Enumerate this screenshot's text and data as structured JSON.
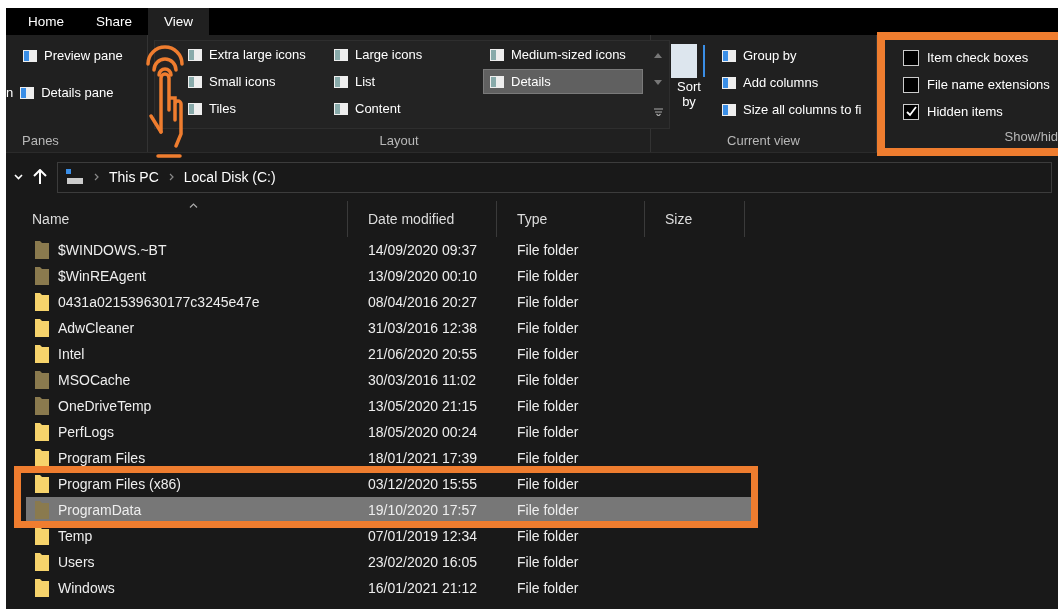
{
  "tabs": [
    {
      "label": "Home",
      "selected": false
    },
    {
      "label": "Share",
      "selected": false
    },
    {
      "label": "View",
      "selected": true
    }
  ],
  "ribbon": {
    "panes": {
      "cut_label": "n",
      "items": [
        "Preview pane",
        "Details pane"
      ],
      "group": "Panes"
    },
    "layout": {
      "group": "Layout",
      "columns": [
        [
          {
            "label": "Extra large icons",
            "selected": false
          },
          {
            "label": "Small icons",
            "selected": false
          },
          {
            "label": "Tiles",
            "selected": false
          }
        ],
        [
          {
            "label": "Large icons",
            "selected": false
          },
          {
            "label": "List",
            "selected": false
          },
          {
            "label": "Content",
            "selected": false
          }
        ],
        [
          {
            "label": "Medium-sized icons",
            "selected": false
          },
          {
            "label": "Details",
            "selected": true
          }
        ]
      ]
    },
    "current_view": {
      "sort_lines": [
        "Sort",
        "by"
      ],
      "items": [
        "Group by",
        "Add columns",
        "Size all columns to fi"
      ],
      "group": "Current view"
    },
    "show_hide": {
      "highlighted": true,
      "group": "Show/hid",
      "options": [
        {
          "label": "Item check boxes",
          "checked": false
        },
        {
          "label": "File name extensions",
          "checked": false
        },
        {
          "label": "Hidden items",
          "checked": true
        }
      ]
    }
  },
  "address": {
    "crumbs": [
      "This PC",
      "Local Disk (C:)"
    ]
  },
  "table": {
    "columns": [
      "Name",
      "Date modified",
      "Type",
      "Size"
    ],
    "rows": [
      {
        "name": "$WINDOWS.~BT",
        "date": "14/09/2020 09:37",
        "type": "File folder",
        "hidden": true,
        "selected": false,
        "highlighted": false
      },
      {
        "name": "$WinREAgent",
        "date": "13/09/2020 00:10",
        "type": "File folder",
        "hidden": true,
        "selected": false,
        "highlighted": false
      },
      {
        "name": "0431a021539630177c3245e47e",
        "date": "08/04/2016 20:27",
        "type": "File folder",
        "hidden": false,
        "selected": false,
        "highlighted": false
      },
      {
        "name": "AdwCleaner",
        "date": "31/03/2016 12:38",
        "type": "File folder",
        "hidden": false,
        "selected": false,
        "highlighted": false
      },
      {
        "name": "Intel",
        "date": "21/06/2020 20:55",
        "type": "File folder",
        "hidden": false,
        "selected": false,
        "highlighted": false
      },
      {
        "name": "MSOCache",
        "date": "30/03/2016 11:02",
        "type": "File folder",
        "hidden": true,
        "selected": false,
        "highlighted": false
      },
      {
        "name": "OneDriveTemp",
        "date": "13/05/2020 21:15",
        "type": "File folder",
        "hidden": true,
        "selected": false,
        "highlighted": false
      },
      {
        "name": "PerfLogs",
        "date": "18/05/2020 00:24",
        "type": "File folder",
        "hidden": false,
        "selected": false,
        "highlighted": false
      },
      {
        "name": "Program Files",
        "date": "18/01/2021 17:39",
        "type": "File folder",
        "hidden": false,
        "selected": false,
        "highlighted": false
      },
      {
        "name": "Program Files (x86)",
        "date": "03/12/2020 15:55",
        "type": "File folder",
        "hidden": false,
        "selected": false,
        "highlighted": true
      },
      {
        "name": "ProgramData",
        "date": "19/10/2020 17:57",
        "type": "File folder",
        "hidden": true,
        "selected": true,
        "highlighted": true
      },
      {
        "name": "Temp",
        "date": "07/01/2019 12:34",
        "type": "File folder",
        "hidden": false,
        "selected": false,
        "highlighted": false
      },
      {
        "name": "Users",
        "date": "23/02/2020 16:05",
        "type": "File folder",
        "hidden": false,
        "selected": false,
        "highlighted": false
      },
      {
        "name": "Windows",
        "date": "16/01/2021 21:12",
        "type": "File folder",
        "hidden": false,
        "selected": false,
        "highlighted": false
      }
    ]
  }
}
